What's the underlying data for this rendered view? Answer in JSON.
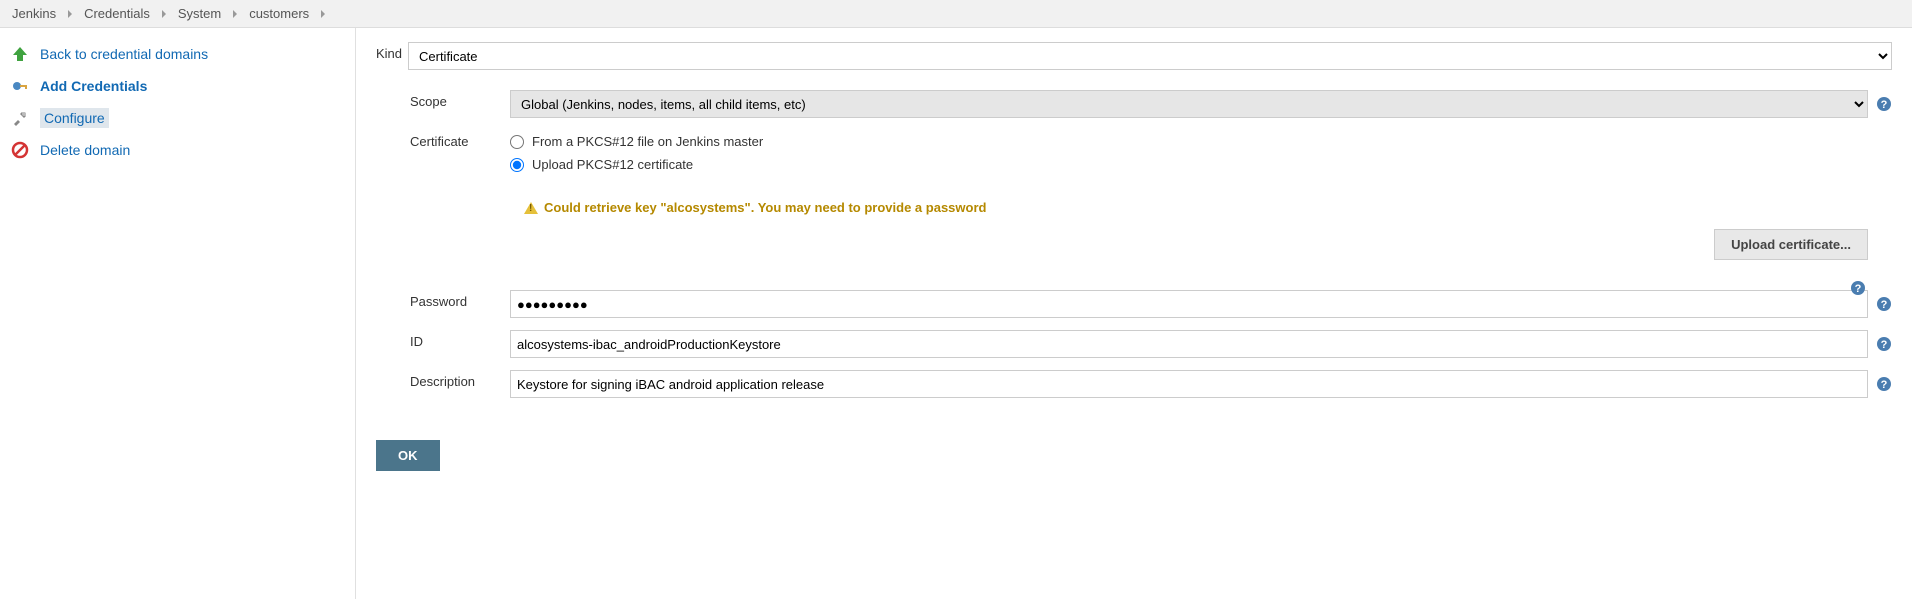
{
  "breadcrumbs": [
    "Jenkins",
    "Credentials",
    "System",
    "customers"
  ],
  "sidebar": {
    "back": "Back to credential domains",
    "add": "Add Credentials",
    "configure": "Configure",
    "delete": "Delete domain"
  },
  "form": {
    "kind_label": "Kind",
    "kind_value": "Certificate",
    "scope_label": "Scope",
    "scope_value": "Global (Jenkins, nodes, items, all child items, etc)",
    "cert_label": "Certificate",
    "cert_opt1": "From a PKCS#12 file on Jenkins master",
    "cert_opt2": "Upload PKCS#12 certificate",
    "warning": "Could retrieve key \"alcosystems\". You may need to provide a password",
    "upload_btn": "Upload certificate...",
    "password_label": "Password",
    "password_value": "●●●●●●●●●",
    "id_label": "ID",
    "id_value": "alcosystems-ibac_androidProductionKeystore",
    "desc_label": "Description",
    "desc_value": "Keystore for signing iBAC android application release",
    "ok": "OK"
  }
}
